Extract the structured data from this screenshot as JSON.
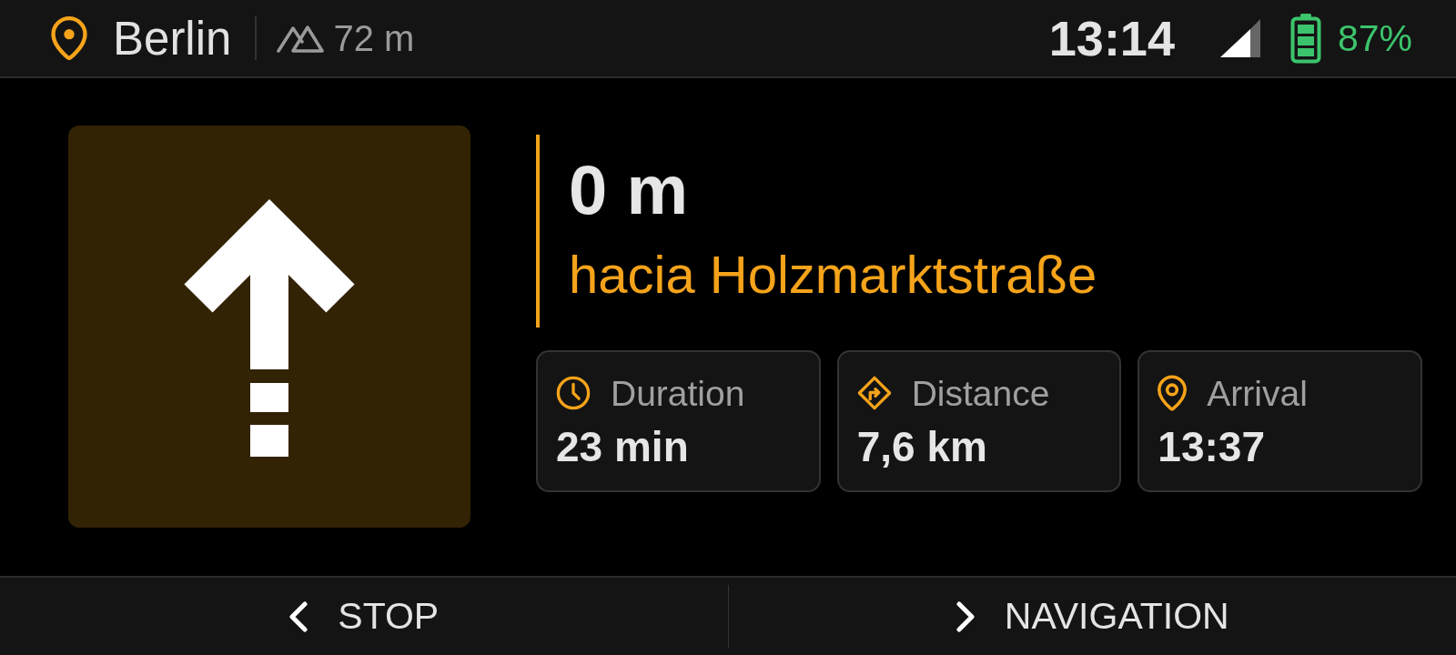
{
  "status_bar": {
    "location": "Berlin",
    "elevation": "72 m",
    "time": "13:14",
    "battery": "87%"
  },
  "maneuver": {
    "kind": "straight",
    "distance": "0 m",
    "street": "hacia Holzmarktstraße"
  },
  "stats": [
    {
      "kind": "duration",
      "label": "Duration",
      "value": "23 min"
    },
    {
      "kind": "distance",
      "label": "Distance",
      "value": "7,6 km"
    },
    {
      "kind": "arrival",
      "label": "Arrival",
      "value": "13:37"
    }
  ],
  "buttons": [
    {
      "kind": "back",
      "label": "STOP"
    },
    {
      "kind": "forward",
      "label": "NAVIGATION"
    }
  ]
}
